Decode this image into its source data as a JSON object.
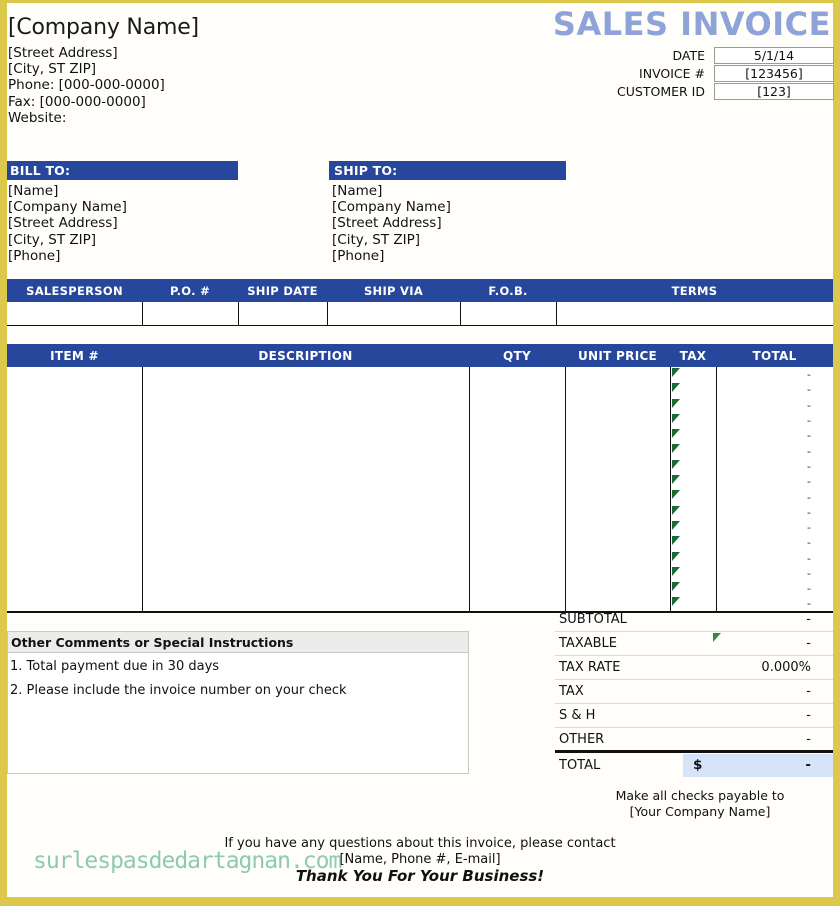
{
  "document": {
    "title": "SALES INVOICE",
    "accent_blue": "#26479c",
    "title_blue": "#8ea4d8",
    "border_gold": "#dcc94b",
    "total_fill": "#d6e3f8",
    "flag_green": "#1d6b34"
  },
  "company": {
    "name": "[Company Name]",
    "street": "[Street Address]",
    "city": "[City, ST  ZIP]",
    "phone": "Phone: [000-000-0000]",
    "fax": "Fax: [000-000-0000]",
    "website": "Website:"
  },
  "meta": {
    "rows": [
      {
        "label": "DATE",
        "value": "5/1/14"
      },
      {
        "label": "INVOICE #",
        "value": "[123456]"
      },
      {
        "label": "CUSTOMER ID",
        "value": "[123]"
      }
    ]
  },
  "bill_to": {
    "heading": "BILL TO:",
    "lines": [
      "[Name]",
      "[Company Name]",
      "[Street Address]",
      "[City, ST  ZIP]",
      "[Phone]"
    ]
  },
  "ship_to": {
    "heading": "SHIP TO:",
    "lines": [
      "[Name]",
      "[Company Name]",
      "[Street Address]",
      "[City, ST  ZIP]",
      "[Phone]"
    ]
  },
  "info_table": {
    "headers": [
      "SALESPERSON",
      "P.O. #",
      "SHIP DATE",
      "SHIP VIA",
      "F.O.B.",
      "TERMS"
    ],
    "values": [
      "",
      "",
      "",
      "",
      "",
      ""
    ]
  },
  "items_table": {
    "headers": [
      "ITEM #",
      "DESCRIPTION",
      "QTY",
      "UNIT PRICE",
      "TAX",
      "TOTAL"
    ],
    "rows": [
      {
        "item": "",
        "description": "",
        "qty": "",
        "unit_price": "",
        "tax_flag": true,
        "total": "-"
      },
      {
        "item": "",
        "description": "",
        "qty": "",
        "unit_price": "",
        "tax_flag": true,
        "total": "-"
      },
      {
        "item": "",
        "description": "",
        "qty": "",
        "unit_price": "",
        "tax_flag": true,
        "total": "-"
      },
      {
        "item": "",
        "description": "",
        "qty": "",
        "unit_price": "",
        "tax_flag": true,
        "total": "-"
      },
      {
        "item": "",
        "description": "",
        "qty": "",
        "unit_price": "",
        "tax_flag": true,
        "total": "-"
      },
      {
        "item": "",
        "description": "",
        "qty": "",
        "unit_price": "",
        "tax_flag": true,
        "total": "-"
      },
      {
        "item": "",
        "description": "",
        "qty": "",
        "unit_price": "",
        "tax_flag": true,
        "total": "-"
      },
      {
        "item": "",
        "description": "",
        "qty": "",
        "unit_price": "",
        "tax_flag": true,
        "total": "-"
      },
      {
        "item": "",
        "description": "",
        "qty": "",
        "unit_price": "",
        "tax_flag": true,
        "total": "-"
      },
      {
        "item": "",
        "description": "",
        "qty": "",
        "unit_price": "",
        "tax_flag": true,
        "total": "-"
      },
      {
        "item": "",
        "description": "",
        "qty": "",
        "unit_price": "",
        "tax_flag": true,
        "total": "-"
      },
      {
        "item": "",
        "description": "",
        "qty": "",
        "unit_price": "",
        "tax_flag": true,
        "total": "-"
      },
      {
        "item": "",
        "description": "",
        "qty": "",
        "unit_price": "",
        "tax_flag": true,
        "total": "-"
      },
      {
        "item": "",
        "description": "",
        "qty": "",
        "unit_price": "",
        "tax_flag": true,
        "total": "-"
      },
      {
        "item": "",
        "description": "",
        "qty": "",
        "unit_price": "",
        "tax_flag": true,
        "total": "-"
      },
      {
        "item": "",
        "description": "",
        "qty": "",
        "unit_price": "",
        "tax_flag": true,
        "total": "-"
      }
    ]
  },
  "comments": {
    "heading": "Other Comments or Special Instructions",
    "lines": [
      "1. Total payment due in 30 days",
      "2. Please include the invoice number on your check"
    ]
  },
  "totals": {
    "rows": [
      {
        "label": "SUBTOTAL",
        "value": "-",
        "flag": false
      },
      {
        "label": "TAXABLE",
        "value": "-",
        "flag": true
      },
      {
        "label": "TAX RATE",
        "value": "0.000%",
        "flag": false
      },
      {
        "label": "TAX",
        "value": "-",
        "flag": false
      },
      {
        "label": "S & H",
        "value": "-",
        "flag": false
      },
      {
        "label": "OTHER",
        "value": "-",
        "flag": false
      }
    ],
    "grand": {
      "label": "TOTAL",
      "currency": "$",
      "value": "-"
    }
  },
  "footer": {
    "payable_line1": "Make all checks payable to",
    "payable_line2": "[Your Company Name]",
    "contact_line1": "If you have any questions about this invoice, please contact",
    "contact_line2": "[Name, Phone #, E-mail]",
    "thanks": "Thank You For Your Business!",
    "watermark": "surlespasdedartagnan.com"
  }
}
